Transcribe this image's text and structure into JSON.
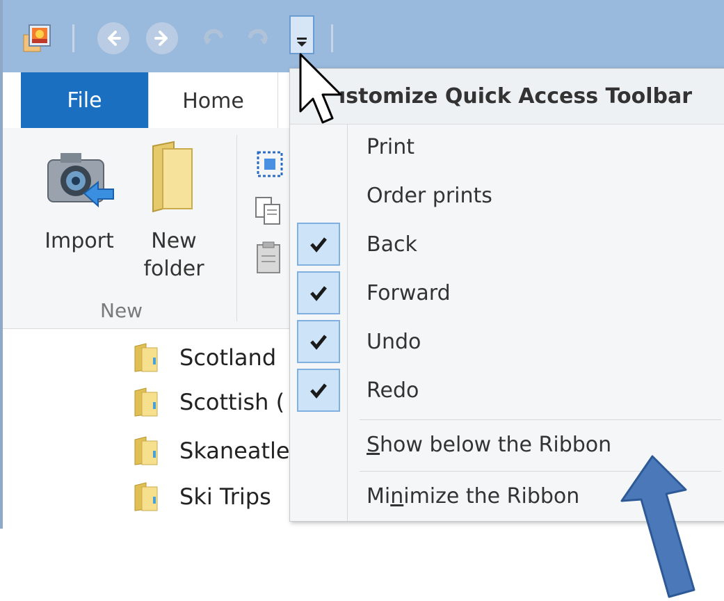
{
  "qat": {
    "icons": [
      "photo-gallery-app-icon",
      "back-icon",
      "forward-icon",
      "undo-icon",
      "redo-icon",
      "customize-dropdown-icon"
    ]
  },
  "tabs": {
    "file": "File",
    "home": "Home"
  },
  "ribbon": {
    "import_label": "Import",
    "new_folder_line1": "New",
    "new_folder_line2": "folder",
    "group_new": "New"
  },
  "files": [
    {
      "name": "Scotland"
    },
    {
      "name": "Scottish ("
    },
    {
      "name": "Skaneatle"
    },
    {
      "name": "Ski Trips"
    }
  ],
  "menu": {
    "title": "Customize Quick Access Toolbar",
    "title_visible": "ıstomize Quick Access Toolbar",
    "items": [
      {
        "label": "Print",
        "checked": false
      },
      {
        "label": "Order prints",
        "checked": false
      },
      {
        "label": "Back",
        "checked": true
      },
      {
        "label": "Forward",
        "checked": true
      },
      {
        "label": "Undo",
        "checked": true
      },
      {
        "label": "Redo",
        "checked": true
      }
    ],
    "show_below": {
      "accel": "S",
      "rest": "how below the Ribbon"
    },
    "minimize": {
      "pre": "Mi",
      "accel": "n",
      "rest": "imize the Ribbon"
    }
  },
  "colors": {
    "qat_bg": "#99b9dd",
    "file_tab": "#1a6fc0",
    "check_bg": "#cde3f8",
    "annotation_arrow": "#4a78b8"
  }
}
